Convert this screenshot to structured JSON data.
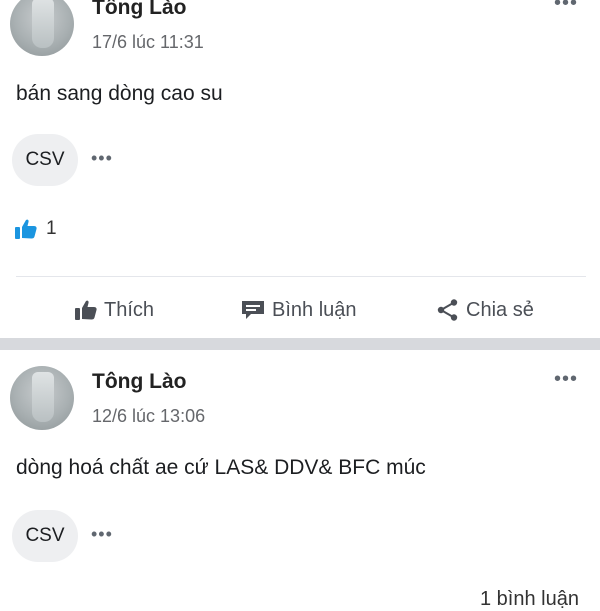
{
  "posts": [
    {
      "author": "Tông Lào",
      "timestamp": "17/6 lúc 11:31",
      "text": "bán sang dòng cao su",
      "tag": "CSV",
      "reaction_count": "1",
      "actions": {
        "like": "Thích",
        "comment": "Bình luận",
        "share": "Chia sẻ"
      }
    },
    {
      "author": "Tông Lào",
      "timestamp": "12/6 lúc 13:06",
      "text": "dòng hoá chất ae cứ LAS& DDV& BFC múc",
      "tag": "CSV",
      "partial_footer": "1 bình luận"
    }
  ],
  "more_label": "•••",
  "icons": [
    "avatar",
    "more-icon",
    "like-icon",
    "comment-icon",
    "share-icon"
  ],
  "colors": {
    "like_blue": "#1b95e0",
    "divider": "#d7d9dd",
    "chip": "#eeeff1",
    "muted": "#65676b"
  }
}
